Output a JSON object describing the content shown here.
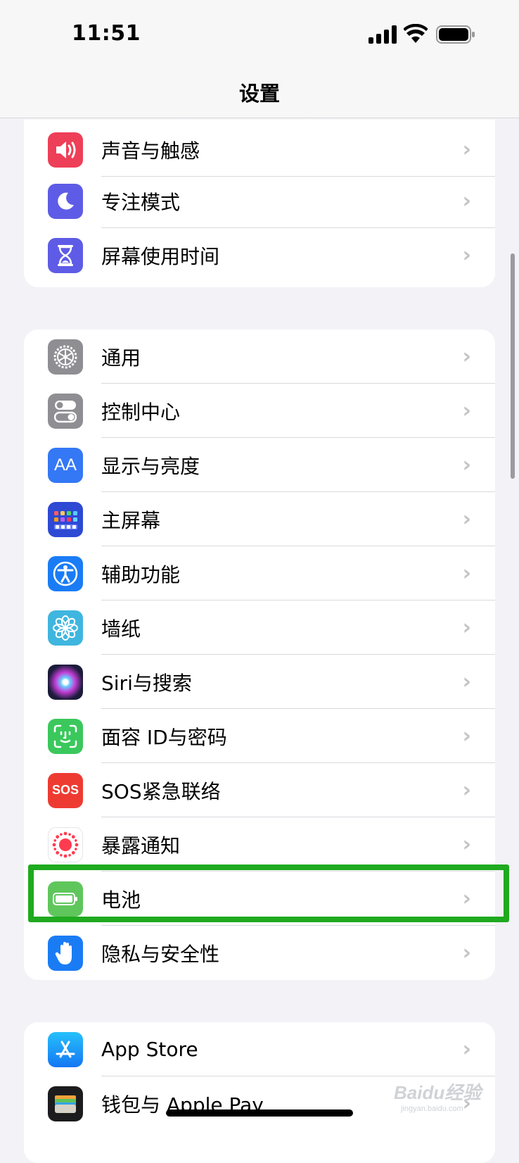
{
  "status": {
    "time": "11:51"
  },
  "nav": {
    "title": "设置"
  },
  "groups": [
    {
      "items": [
        {
          "label": "声音与触感",
          "icon": "speaker-icon",
          "color": "#ee3f58"
        },
        {
          "label": "专注模式",
          "icon": "moon-icon",
          "color": "#5e5ce6"
        },
        {
          "label": "屏幕使用时间",
          "icon": "hourglass-icon",
          "color": "#5e5ce6"
        }
      ]
    },
    {
      "items": [
        {
          "label": "通用",
          "icon": "gear-icon",
          "color": "#8e8e93"
        },
        {
          "label": "控制中心",
          "icon": "toggles-icon",
          "color": "#8e8e93"
        },
        {
          "label": "显示与亮度",
          "icon": "text-size-icon",
          "color": "#3478f6",
          "icon_text": "AA"
        },
        {
          "label": "主屏幕",
          "icon": "home-grid-icon",
          "color": "#2e49d4"
        },
        {
          "label": "辅助功能",
          "icon": "accessibility-icon",
          "color": "#1a7cf5"
        },
        {
          "label": "墙纸",
          "icon": "flower-icon",
          "color": "#3fb6df"
        },
        {
          "label": "Siri与搜索",
          "icon": "siri-icon",
          "color": "#1b1b3a"
        },
        {
          "label": "面容 ID与密码",
          "icon": "face-id-icon",
          "color": "#3ac85c"
        },
        {
          "label": "SOS紧急联络",
          "icon": "sos-icon",
          "color": "#ee3b32",
          "icon_text": "SOS"
        },
        {
          "label": "暴露通知",
          "icon": "exposure-icon",
          "color": "#ffffff"
        },
        {
          "label": "电池",
          "icon": "battery-icon",
          "color": "#5fc65c"
        },
        {
          "label": "隐私与安全性",
          "icon": "hand-icon",
          "color": "#1a7cf5"
        }
      ]
    },
    {
      "items": [
        {
          "label": "App Store",
          "icon": "app-store-icon",
          "color": "#1a8cf5"
        },
        {
          "label": "钱包与 Apple Pay",
          "icon": "wallet-icon",
          "color": "#1c1c1e"
        }
      ]
    }
  ],
  "chevron": "›",
  "watermark": {
    "main": "Baidu经验",
    "sub": "jingyan.baidu.com"
  }
}
